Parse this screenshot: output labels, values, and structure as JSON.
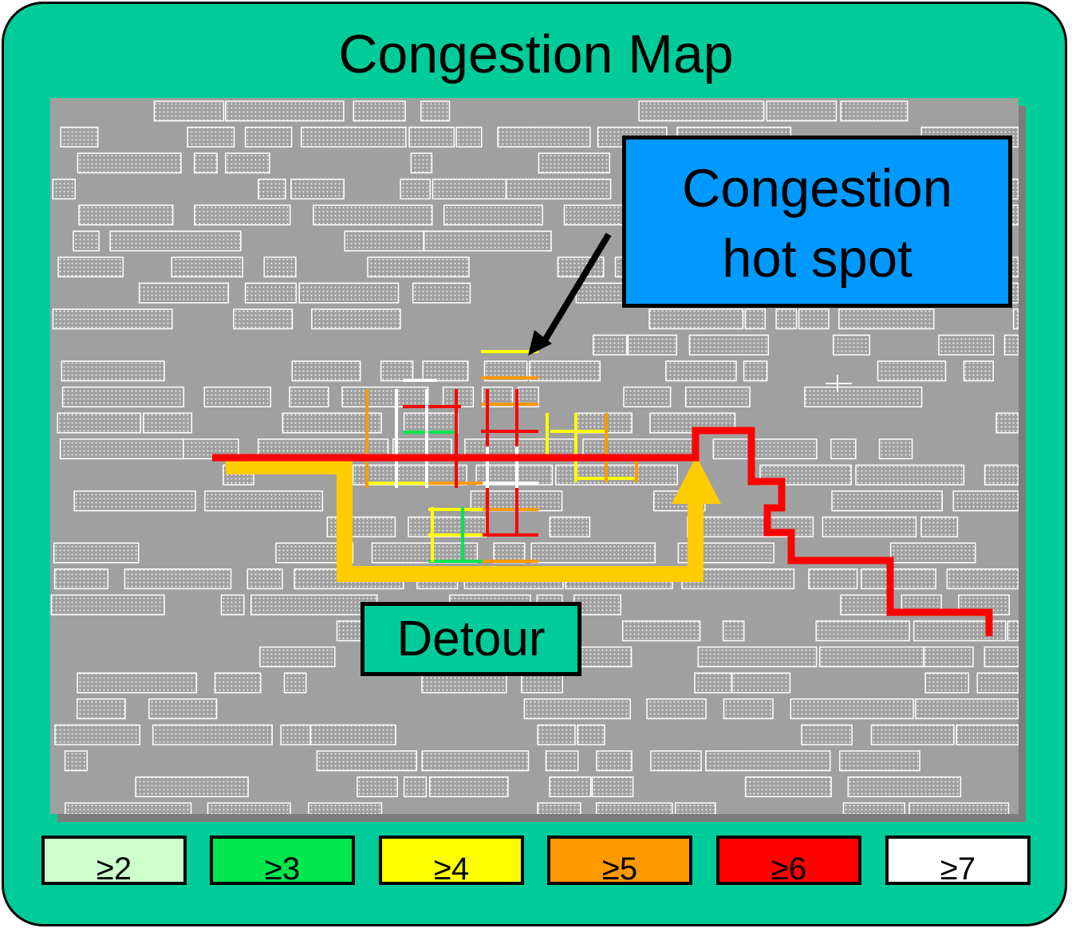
{
  "title": "Congestion Map",
  "callouts": {
    "hotspot": {
      "line1": "Congestion",
      "line2": "hot spot"
    },
    "detour": "Detour"
  },
  "legend": [
    {
      "label": "≥2",
      "color": "#ccffcc",
      "text_color": "#000000"
    },
    {
      "label": "≥3",
      "color": "#00e64d",
      "text_color": "#000000"
    },
    {
      "label": "≥4",
      "color": "#ffff00",
      "text_color": "#000000"
    },
    {
      "label": "≥5",
      "color": "#ff9900",
      "text_color": "#000000"
    },
    {
      "label": "≥6",
      "color": "#ff0000",
      "text_color": "#000000"
    },
    {
      "label": "≥7",
      "color": "#ffffff",
      "text_color": "#000000"
    }
  ],
  "colors": {
    "frame": "#00cc99",
    "layout_background": "#a0a0a0",
    "cell_outline": "#ffffff",
    "hotspot_box": "#0099ff",
    "detour_route": "#ffcc00",
    "congested_route": "#ff0000"
  }
}
